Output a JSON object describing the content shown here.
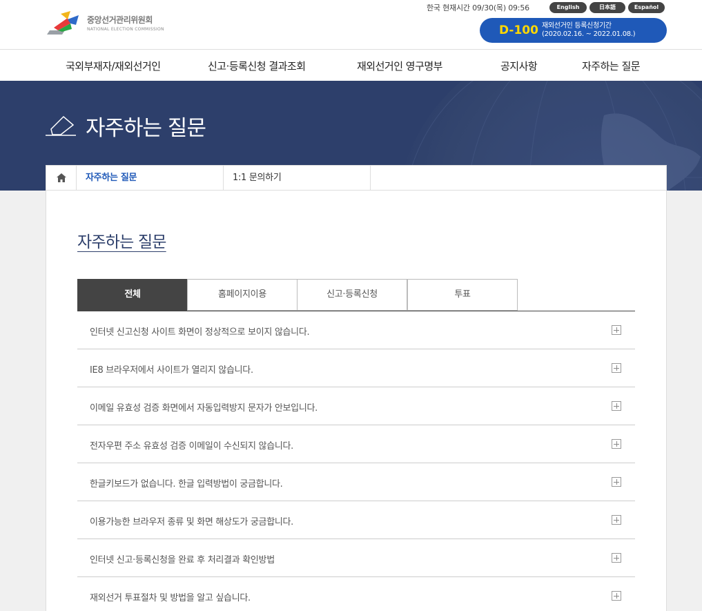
{
  "header": {
    "logo_kr": "중앙선거관리위원회",
    "logo_en": "NATIONAL ELECTION COMMISSION",
    "clock": "한국 현재시간 09/30(목) 09:56",
    "languages": [
      "English",
      "日本語",
      "Español"
    ],
    "dday_num": "D-100",
    "dday_line1": "재외선거인 등록신청기간",
    "dday_line2": "(2020.02.16. ~ 2022.01.08.)",
    "accent": "#1f59b8",
    "dday_color": "#ffd800"
  },
  "nav": {
    "items": [
      "국외부재자/재외선거인",
      "신고·등록신청 결과조회",
      "재외선거인 영구명부",
      "공지사항",
      "자주하는 질문"
    ]
  },
  "banner": {
    "title": "자주하는 질문",
    "bg_color": "#2d3f6b"
  },
  "subnav": {
    "items": [
      "자주하는 질문",
      "1:1 문의하기"
    ]
  },
  "main": {
    "title": "자주하는 질문",
    "tabs": [
      "전체",
      "홈페이지이용",
      "신고·등록신청",
      "투표"
    ],
    "faq": [
      "인터넷 신고신청 사이트 화면이 정상적으로 보이지 않습니다.",
      "IE8 브라우저에서 사이트가 열리지 않습니다.",
      "이메일 유효성 검증 화면에서 자동입력방지 문자가 안보입니다.",
      "전자우편 주소 유효성 검증 이메일이 수신되지 않습니다.",
      "한글키보드가 없습니다. 한글 입력방법이 궁금합니다.",
      "이용가능한 브라우저 종류 및 화면 해상도가 궁금합니다.",
      "인터넷 신고·등록신청을 완료 후 처리결과 확인방법",
      "재외선거 투표절차 및 방법을 알고 싶습니다."
    ]
  }
}
